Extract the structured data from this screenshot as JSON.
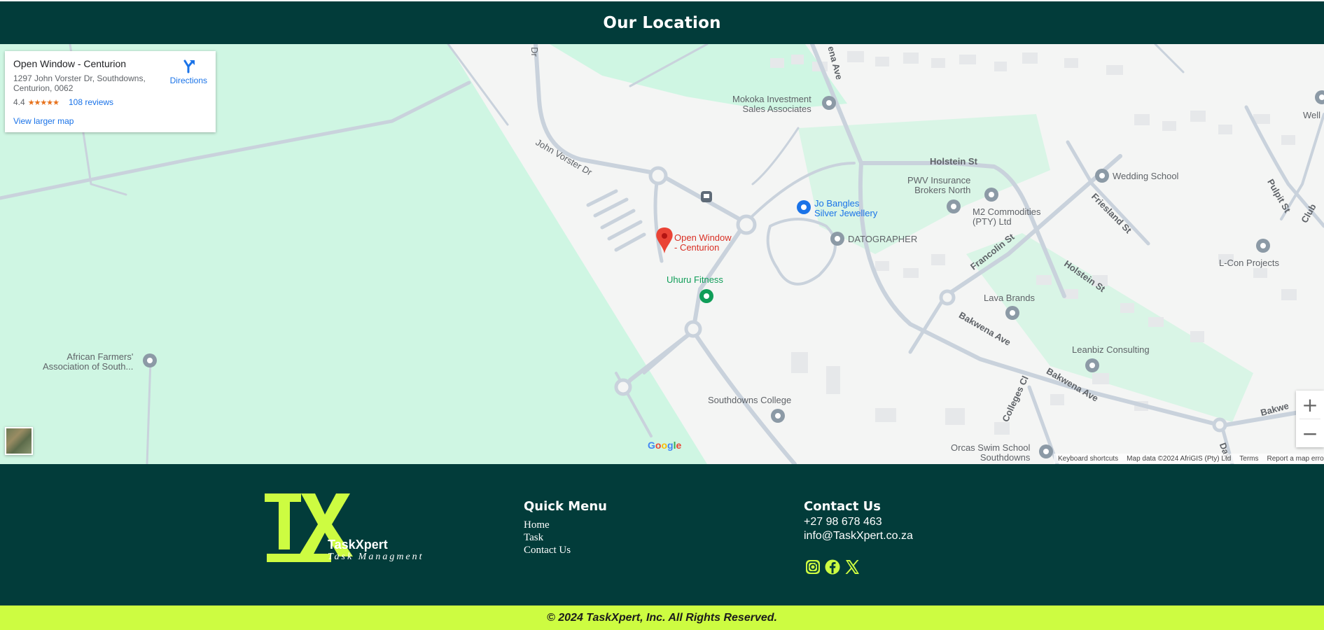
{
  "header": {
    "title": "Our Location"
  },
  "place_card": {
    "name": "Open Window - Centurion",
    "address": "1297 John Vorster Dr, Southdowns, Centurion, 0062",
    "rating": "4.4",
    "stars": "★★★★★",
    "reviews": "108 reviews",
    "directions_label": "Directions",
    "larger_map_label": "View larger map"
  },
  "map": {
    "zoom_in": "+",
    "zoom_out": "−",
    "google_logo": "Google",
    "attribution": {
      "shortcuts": "Keyboard shortcuts",
      "data": "Map data ©2024 AfriGIS (Pty) Ltd",
      "terms": "Terms",
      "report": "Report a map erro"
    },
    "labels": {
      "john_vorster": "John Vorster Dr",
      "dr_top": "Dr",
      "bakwena_top": "ena Ave",
      "holstein": "Holstein St",
      "holstein2": "Holstein St",
      "francolin": "Francolin St",
      "friesland": "Friesland St",
      "pulpit": "Pulpit St",
      "club": "Club",
      "bakwena1": "Bakwena Ave",
      "bakwena2": "Bakwena Ave",
      "bakwena3": "Bakwe",
      "colleges": "Colleges Cl",
      "dair": "Dair",
      "mokoka": "Mokoka Investment\nSales Associates",
      "pwv": "PWV Insurance\nBrokers North",
      "jo_bangles": "Jo Bangles\nSilver Jewellery",
      "datographer": "DATOGRAPHER",
      "m2": "M2 Commodities\n(PTY) Ltd",
      "wedding": "Wedding School",
      "lcon": "L-Con Projects",
      "well": "Well",
      "lava": "Lava Brands",
      "leanbiz": "Leanbiz Consulting",
      "uhuru": "Uhuru Fitness",
      "openwindow": "Open Window\n- Centurion",
      "african": "African Farmers'\nAssociation of South...",
      "southdowns": "Southdowns College",
      "orcas": "Orcas Swim School\nSouthdowns"
    }
  },
  "footer": {
    "logo_mark": "TX",
    "brand": "TaskXpert",
    "tagline": "Task Managment",
    "quick_menu": {
      "title": "Quick Menu",
      "links": [
        "Home",
        "Task",
        "Contact Us"
      ]
    },
    "contact": {
      "title": "Contact Us",
      "phone": "+27 98 678 463",
      "email": "info@TaskXpert.co.za"
    },
    "social_icons": [
      "instagram-icon",
      "facebook-icon",
      "x-icon"
    ],
    "copyright": "© 2024 TaskXpert, Inc. All Rights Reserved."
  },
  "colors": {
    "primary_dark": "#023c3a",
    "accent_lime": "#cdfc41",
    "map_park": "#cff6e3",
    "map_road": "#c9d2dc",
    "pin_red": "#ea4335"
  }
}
